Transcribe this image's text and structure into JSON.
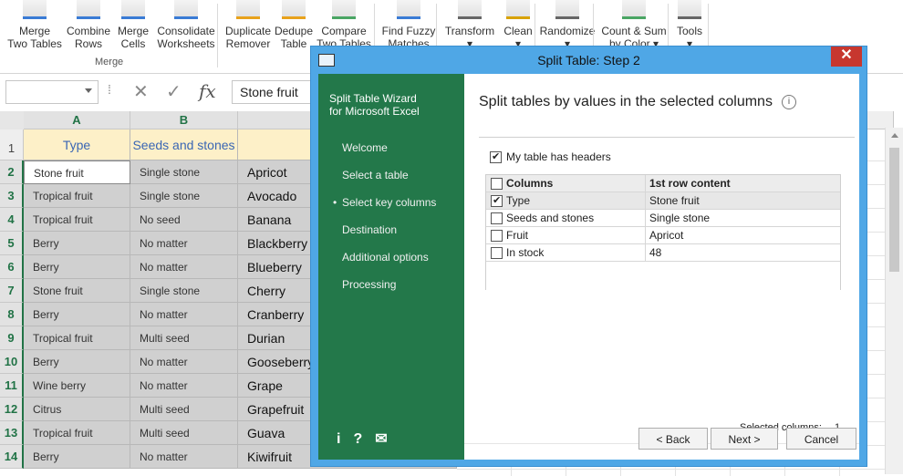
{
  "ribbon": {
    "buttons": [
      {
        "label": "Merge\nTwo Tables",
        "icon": "merge-tables-icon"
      },
      {
        "label": "Combine\nRows",
        "icon": "combine-rows-icon"
      },
      {
        "label": "Merge\nCells",
        "icon": "merge-cells-icon"
      },
      {
        "label": "Consolidate\nWorksheets",
        "icon": "consolidate-icon"
      },
      {
        "label": "Duplicate\nRemover",
        "icon": "duplicate-remover-icon"
      },
      {
        "label": "Dedupe\nTable",
        "icon": "dedupe-table-icon"
      },
      {
        "label": "Compare\nTwo Tables",
        "icon": "compare-tables-icon"
      },
      {
        "label": "Find Fuzzy\nMatches",
        "icon": "fuzzy-match-icon"
      },
      {
        "label": "Transform\n▾",
        "icon": "transform-icon"
      },
      {
        "label": "Clean\n▾",
        "icon": "clean-icon"
      },
      {
        "label": "Randomize\n▾",
        "icon": "randomize-icon"
      },
      {
        "label": "Count & Sum\nby Color ▾",
        "icon": "count-sum-icon"
      },
      {
        "label": "Tools\n▾",
        "icon": "gear-icon"
      }
    ],
    "group_label": "Merge"
  },
  "formula_bar": {
    "name_box": "",
    "value": "Stone fruit"
  },
  "sheet": {
    "columns": [
      "A",
      "B",
      "C"
    ],
    "rows": [
      {
        "n": "1",
        "a": "Type",
        "b": "Seeds and stones",
        "c": "Fr"
      },
      {
        "n": "2",
        "a": "Stone fruit",
        "b": "Single stone",
        "c": "Apricot"
      },
      {
        "n": "3",
        "a": "Tropical fruit",
        "b": "Single stone",
        "c": "Avocado"
      },
      {
        "n": "4",
        "a": "Tropical fruit",
        "b": "No seed",
        "c": "Banana"
      },
      {
        "n": "5",
        "a": "Berry",
        "b": "No matter",
        "c": "Blackberry"
      },
      {
        "n": "6",
        "a": "Berry",
        "b": "No matter",
        "c": "Blueberry"
      },
      {
        "n": "7",
        "a": "Stone fruit",
        "b": "Single stone",
        "c": "Cherry"
      },
      {
        "n": "8",
        "a": "Berry",
        "b": "No matter",
        "c": "Cranberry"
      },
      {
        "n": "9",
        "a": "Tropical fruit",
        "b": "Multi seed",
        "c": "Durian"
      },
      {
        "n": "10",
        "a": "Berry",
        "b": "No matter",
        "c": "Gooseberry"
      },
      {
        "n": "11",
        "a": "Wine berry",
        "b": "No matter",
        "c": "Grape"
      },
      {
        "n": "12",
        "a": "Citrus",
        "b": "Multi seed",
        "c": "Grapefruit"
      },
      {
        "n": "13",
        "a": "Tropical fruit",
        "b": "Multi seed",
        "c": "Guava"
      },
      {
        "n": "14",
        "a": "Berry",
        "b": "No matter",
        "c": "Kiwifruit"
      }
    ]
  },
  "dialog": {
    "title": "Split Table: Step 2",
    "close_label": "✕",
    "sidebar": {
      "heading": "Split Table Wizard\nfor Microsoft Excel",
      "items": [
        {
          "label": "Welcome",
          "current": false
        },
        {
          "label": "Select a table",
          "current": false
        },
        {
          "label": "Select key columns",
          "current": true
        },
        {
          "label": "Destination",
          "current": false
        },
        {
          "label": "Additional options",
          "current": false
        },
        {
          "label": "Processing",
          "current": false
        }
      ],
      "icons": [
        "i",
        "?",
        "✉"
      ]
    },
    "heading": "Split tables by values in the selected columns",
    "info_label": "i",
    "has_headers_label": "My table has headers",
    "has_headers_checked": true,
    "table": {
      "headers": [
        "Columns",
        "1st row content"
      ],
      "rows": [
        {
          "column": "Type",
          "content": "Stone fruit",
          "checked": true
        },
        {
          "column": "Seeds and stones",
          "content": "Single stone",
          "checked": false
        },
        {
          "column": "Fruit",
          "content": "Apricot",
          "checked": false
        },
        {
          "column": "In stock",
          "content": "48",
          "checked": false
        }
      ]
    },
    "selected_columns_label": "Selected columns:",
    "selected_columns_count": "1",
    "buttons": {
      "back": "< Back",
      "next": "Next >",
      "cancel": "Cancel"
    }
  },
  "colors": {
    "accent_green": "#217346",
    "sidebar_green": "#23784a",
    "dialog_frame": "#4fa7e6",
    "close_red": "#c7372f",
    "header_fill": "#fdf0c8"
  }
}
